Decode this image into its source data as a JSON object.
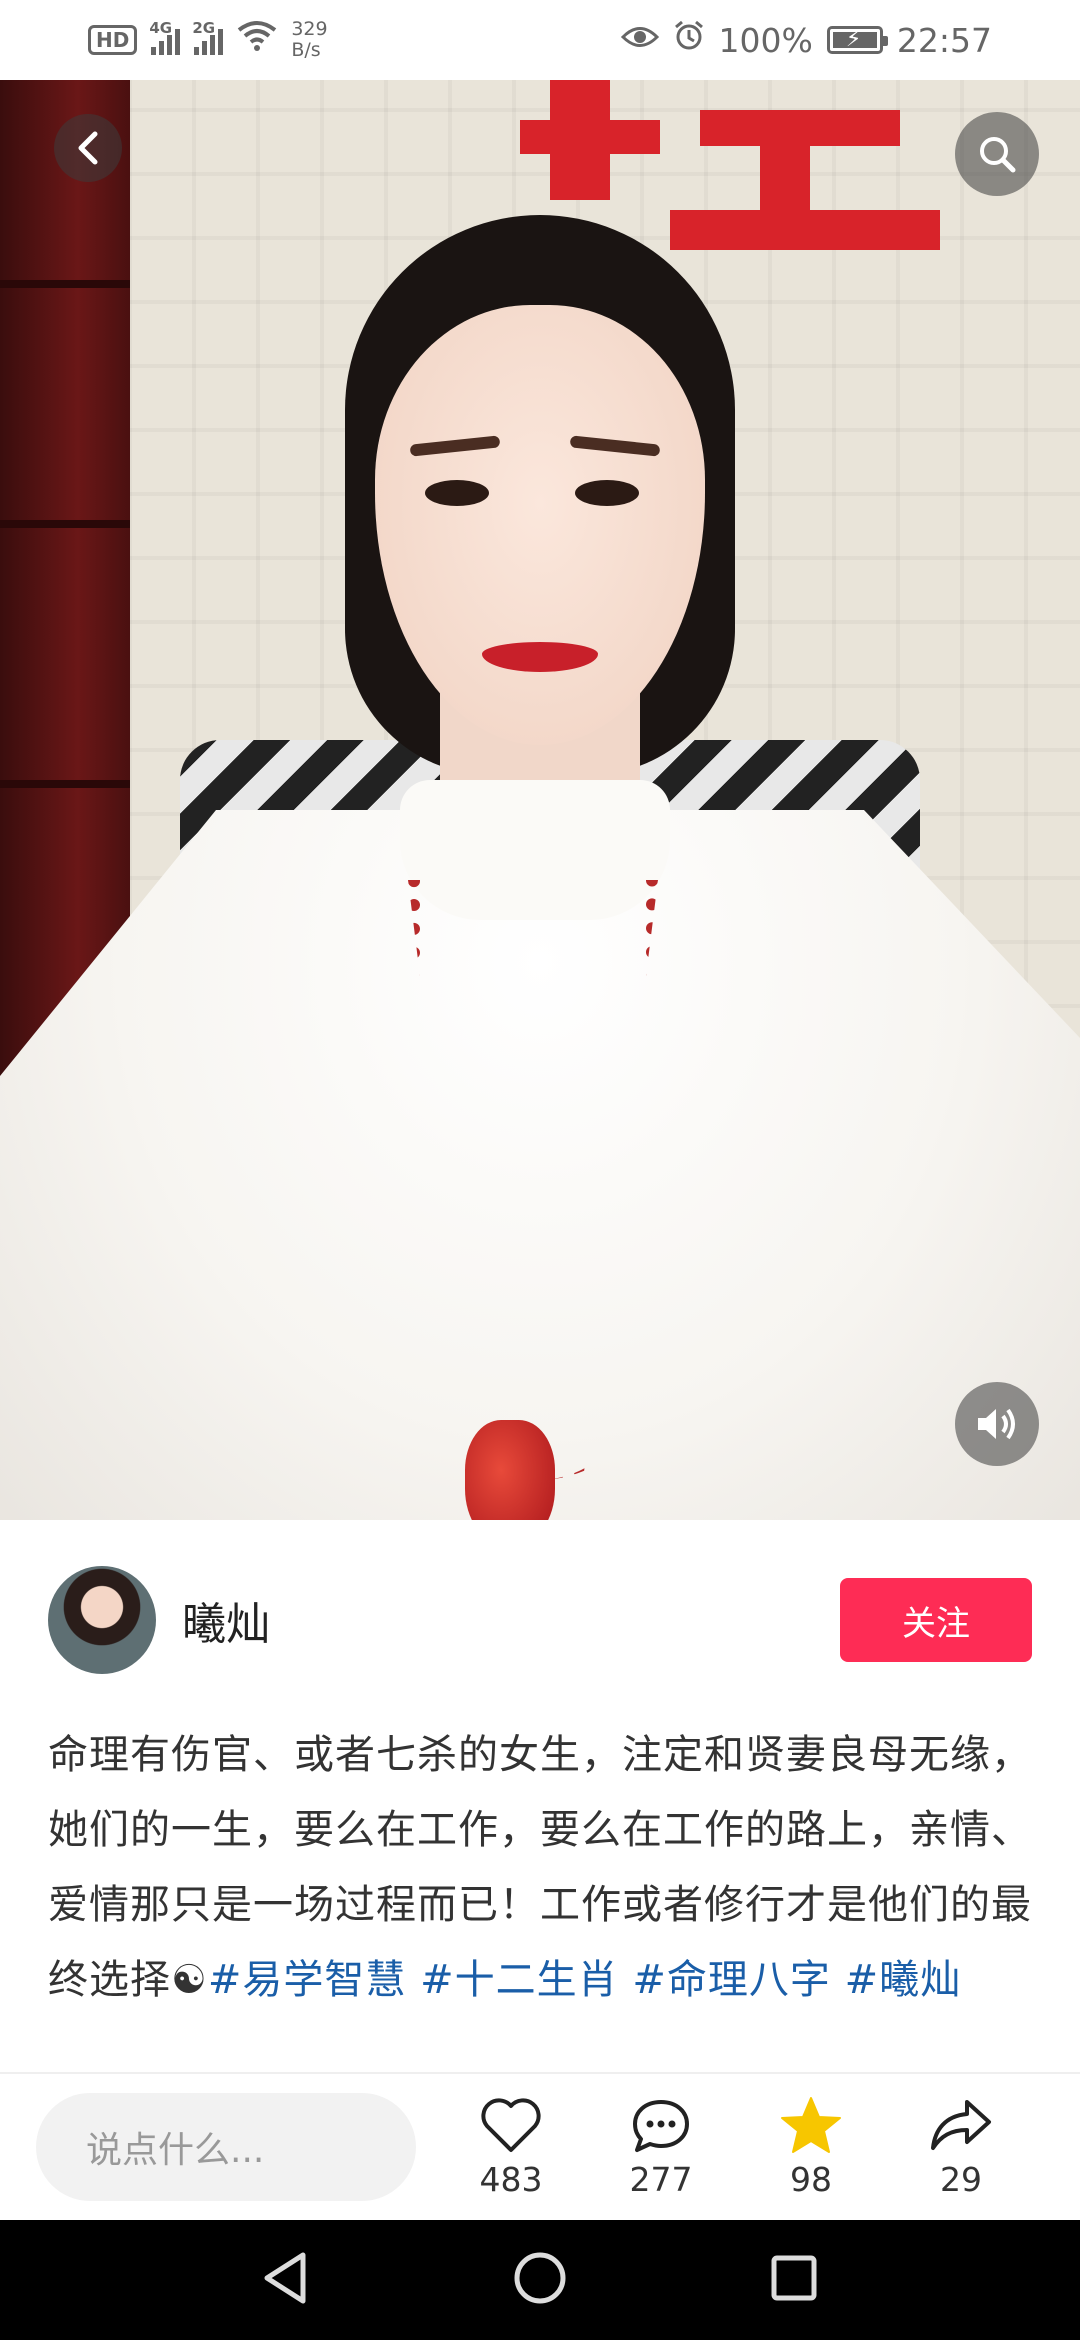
{
  "status_bar": {
    "hd_label": "HD",
    "sim1_label": "4G",
    "sim2_label": "2G",
    "net_speed_value": "329",
    "net_speed_unit": "B/s",
    "battery_percent": "100%",
    "time": "22:57",
    "icons": [
      "eye-icon",
      "alarm-icon",
      "battery-charging-icon",
      "wifi-icon",
      "signal-icon"
    ]
  },
  "media": {
    "description": "photo of a woman in a white blouse with a red bead necklace",
    "icons": [
      "back-icon",
      "search-icon",
      "volume-icon"
    ]
  },
  "author": {
    "name": "曦灿",
    "follow_label": "关注"
  },
  "post": {
    "text": "命理有伤官、或者七杀的女生，注定和贤妻良母无缘，她们的一生，要么在工作，要么在工作的路上，亲情、爱情那只是一场过程而已！工作或者修行才是他们的最终选择",
    "emoji": "☯",
    "hashtags": [
      "#易学智慧",
      "#十二生肖",
      "#命理八字",
      "#曦灿"
    ]
  },
  "actions": {
    "comment_placeholder": "说点什么...",
    "like_count": "483",
    "comment_count": "277",
    "collect_count": "98",
    "share_count": "29",
    "collect_color": "#f7c600"
  },
  "nav": {
    "icons": [
      "nav-back-icon",
      "nav-home-icon",
      "nav-recents-icon"
    ]
  }
}
